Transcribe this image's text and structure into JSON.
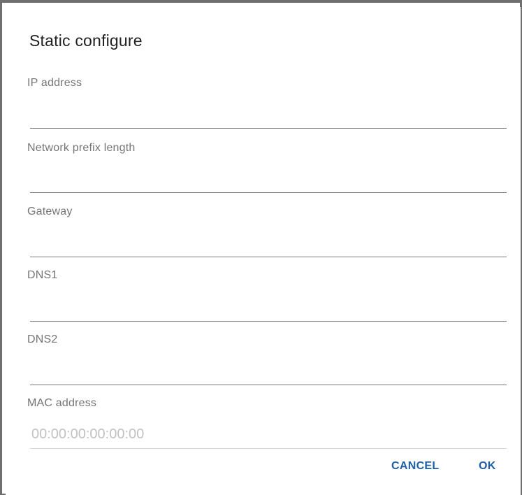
{
  "dialog": {
    "title": "Static configure",
    "fields": [
      {
        "label": "IP address",
        "value": "",
        "placeholder": ""
      },
      {
        "label": "Network prefix length",
        "value": "",
        "placeholder": ""
      },
      {
        "label": "Gateway",
        "value": "",
        "placeholder": ""
      },
      {
        "label": "DNS1",
        "value": "",
        "placeholder": ""
      },
      {
        "label": "DNS2",
        "value": "",
        "placeholder": ""
      },
      {
        "label": "MAC address",
        "value": "",
        "placeholder": "00:00:00:00:00:00"
      }
    ],
    "buttons": {
      "cancel": "CANCEL",
      "ok": "OK"
    }
  },
  "colors": {
    "accent": "#1f5fa4",
    "title_text": "#212121",
    "label_text": "#757575",
    "placeholder_text": "#c2c2c2",
    "frame": "#6f6f6f"
  }
}
